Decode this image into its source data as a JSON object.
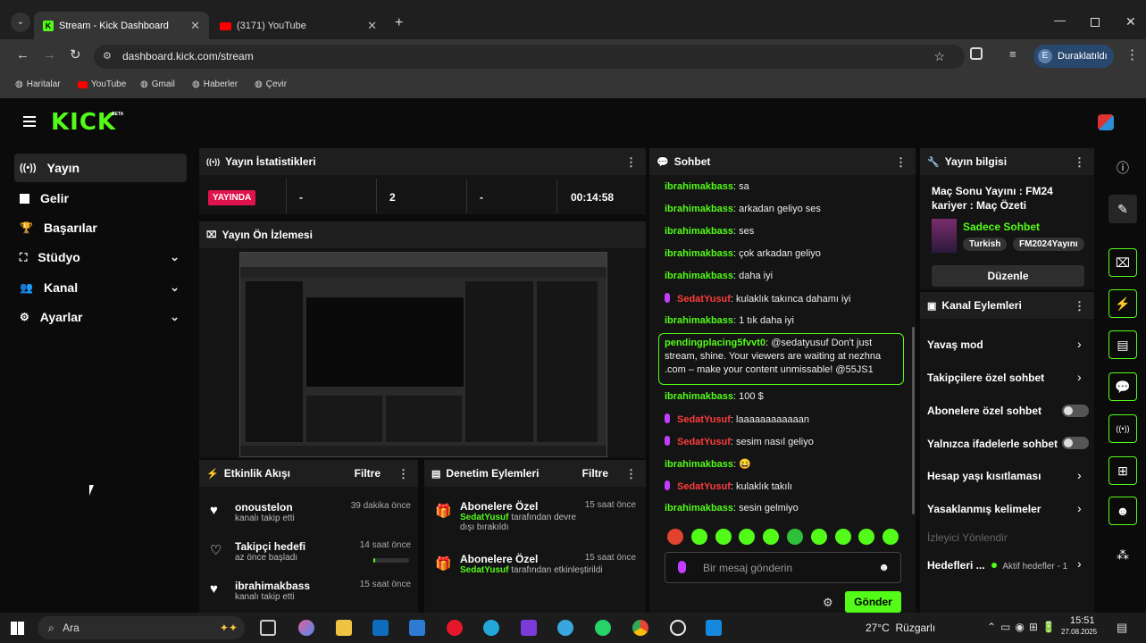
{
  "browser": {
    "tabs": [
      {
        "title": "Stream - Kick Dashboard"
      },
      {
        "title": "(3171) YouTube"
      }
    ],
    "url": "dashboard.kick.com/stream",
    "profile": {
      "initial": "E",
      "label": "Duraklatıldı"
    },
    "bookmarks": [
      "Haritalar",
      "YouTube",
      "Gmail",
      "Haberler",
      "Çevir"
    ]
  },
  "app": {
    "logo": "KICK",
    "logo_badge": "BETA",
    "nav": [
      {
        "label": "Yayın",
        "icon": "broadcast-icon",
        "active": true
      },
      {
        "label": "Gelir",
        "icon": "chart-icon"
      },
      {
        "label": "Başarılar",
        "icon": "trophy-icon"
      },
      {
        "label": "Stüdyo",
        "icon": "studio-icon",
        "expandable": true
      },
      {
        "label": "Kanal",
        "icon": "people-icon",
        "expandable": true
      },
      {
        "label": "Ayarlar",
        "icon": "gear-icon",
        "expandable": true
      }
    ]
  },
  "stats": {
    "title": "Yayın İstatistikleri",
    "live_badge": "YAYINDA",
    "cells": [
      "-",
      "2",
      "-",
      "00:14:58"
    ]
  },
  "preview": {
    "title": "Yayın Ön İzlemesi"
  },
  "activity": {
    "title": "Etkinlik Akışı",
    "filter": "Filtre",
    "items": [
      {
        "title": "onoustelon",
        "sub": "kanalı takip etti",
        "time": "39 dakika önce"
      },
      {
        "title": "Takipçi hedefi",
        "sub": "az önce başladı",
        "time": "14 saat önce",
        "progress": 0.05
      },
      {
        "title": "ibrahimakbass",
        "sub": "kanalı takip etti",
        "time": "15 saat önce"
      }
    ]
  },
  "moderation": {
    "title": "Denetim Eylemleri",
    "filter": "Filtre",
    "items": [
      {
        "title": "Abonelere Özel",
        "user": "SedatYusuf",
        "sub": "tarafından devre dışı bırakıldı",
        "time": "15 saat önce"
      },
      {
        "title": "Abonelere Özel",
        "user": "SedatYusuf",
        "sub": "tarafından etkinleştirildi",
        "time": "15 saat önce"
      }
    ]
  },
  "chat": {
    "title": "Sohbet",
    "messages": [
      {
        "user": "ibrahimakbass",
        "text": ": sa"
      },
      {
        "user": "ibrahimakbass",
        "text": ": arkadan geliyo ses"
      },
      {
        "user": "ibrahimakbass",
        "text": ": ses"
      },
      {
        "user": "ibrahimakbass",
        "text": ": çok arkadan geliyo"
      },
      {
        "user": "ibrahimakbass",
        "text": ": daha iyi"
      },
      {
        "user": "SedatYusuf",
        "text": ": kulaklık takınca dahamı iyi",
        "mod": true
      },
      {
        "user": "ibrahimakbass",
        "text": ": 1 tık daha iyi"
      }
    ],
    "highlight": {
      "user": "pendingplacing5fvvt0",
      "text": ": @sedatyusuf Don't just stream, shine. Your viewers are waiting at nezhna .com – make your content unmissable! @55JS1"
    },
    "messages2": [
      {
        "user": "ibrahimakbass",
        "text": ": 100 $"
      },
      {
        "user": "SedatYusuf",
        "text": ": laaaaaaaaaaaan",
        "mod": true
      },
      {
        "user": "SedatYusuf",
        "text": ": sesim nasıl geliyo",
        "mod": true
      },
      {
        "user": "ibrahimakbass",
        "text": ": 😄"
      },
      {
        "user": "SedatYusuf",
        "text": ": kulaklık takılı",
        "mod": true
      },
      {
        "user": "ibrahimakbass",
        "text": ": sesin gelmiyo"
      }
    ],
    "placeholder": "Bir mesaj gönderin",
    "send": "Gönder"
  },
  "info": {
    "title": "Yayın bilgisi",
    "stream_title": "Maç Sonu Yayını : FM24 kariyer : Maç Özeti",
    "category": "Sadece Sohbet",
    "tags": [
      "Turkish",
      "FM2024Yayını"
    ],
    "edit": "Düzenle"
  },
  "channel_actions": {
    "title": "Kanal Eylemleri",
    "items": [
      {
        "label": "Yavaş mod",
        "type": "chevron"
      },
      {
        "label": "Takipçilere özel sohbet",
        "type": "chevron"
      },
      {
        "label": "Abonelere özel sohbet",
        "type": "toggle"
      },
      {
        "label": "Yalnızca ifadelerle sohbet",
        "type": "toggle"
      },
      {
        "label": "Hesap yaşı kısıtlaması",
        "type": "chevron"
      },
      {
        "label": "Yasaklanmış kelimeler",
        "type": "chevron"
      }
    ],
    "viewer_redirect": "İzleyici Yönlendir",
    "goals_label": "Hedefleri ...",
    "goals_value": "Aktif hedefler - 1"
  },
  "taskbar": {
    "search": "Ara",
    "weather": "27°C  Rüzgarlı",
    "time": "15:51",
    "date": "27.08.2025"
  }
}
